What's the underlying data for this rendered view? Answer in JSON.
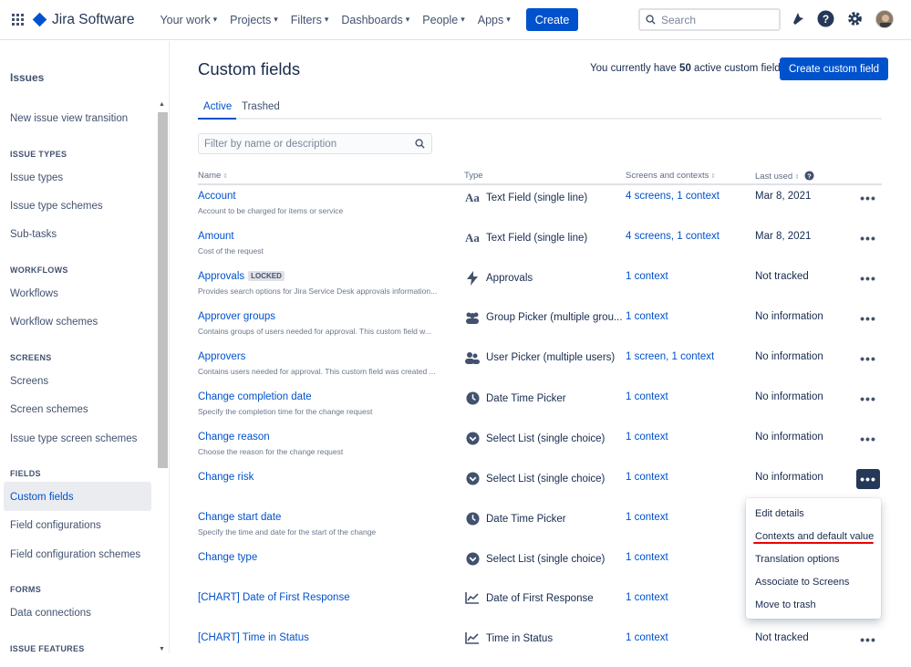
{
  "topnav": {
    "product": "Jira Software",
    "items": [
      "Your work",
      "Projects",
      "Filters",
      "Dashboards",
      "People",
      "Apps"
    ],
    "create_label": "Create",
    "search_placeholder": "Search",
    "icons": [
      "notifications-icon",
      "help-icon",
      "settings-icon",
      "avatar"
    ]
  },
  "sidebar": {
    "title": "Issues",
    "transition": "New issue view transition",
    "sections": {
      "issue_types": "ISSUE TYPES",
      "workflows": "WORKFLOWS",
      "screens": "SCREENS",
      "fields": "FIELDS",
      "forms": "FORMS",
      "issue_features": "ISSUE FEATURES"
    },
    "items": {
      "issue_types": "Issue types",
      "issue_type_schemes": "Issue type schemes",
      "sub_tasks": "Sub-tasks",
      "workflows": "Workflows",
      "workflow_schemes": "Workflow schemes",
      "screens": "Screens",
      "screen_schemes": "Screen schemes",
      "issue_type_screen_schemes": "Issue type screen schemes",
      "custom_fields": "Custom fields",
      "field_configurations": "Field configurations",
      "field_configuration_schemes": "Field configuration schemes",
      "data_connections": "Data connections"
    }
  },
  "main": {
    "title": "Custom fields",
    "count_prefix": "You currently have",
    "count_value": "50",
    "count_suffix": "active custom fields",
    "create_button": "Create custom field",
    "tabs": [
      "Active",
      "Trashed"
    ],
    "filter_placeholder": "Filter by name or description",
    "columns": {
      "name": "Name",
      "type": "Type",
      "screens": "Screens and contexts",
      "last_used": "Last used"
    },
    "rows": [
      {
        "name": "Account",
        "desc": "Account to be charged for items or service",
        "type": "Text Field (single line)",
        "icon": "text-field-icon",
        "screens": "4 screens, 1 context",
        "last_used": "Mar 8, 2021"
      },
      {
        "name": "Amount",
        "desc": "Cost of the request",
        "type": "Text Field (single line)",
        "icon": "text-field-icon",
        "screens": "4 screens, 1 context",
        "last_used": "Mar 8, 2021"
      },
      {
        "name": "Approvals",
        "badge": "LOCKED",
        "desc": "Provides search options for Jira Service Desk approvals information...",
        "type": "Approvals",
        "icon": "lightning-icon",
        "screens": "1 context",
        "last_used": "Not tracked"
      },
      {
        "name": "Approver groups",
        "desc": "Contains groups of users needed for approval. This custom field w...",
        "type": "Group Picker (multiple grou...",
        "icon": "group-icon",
        "screens": "1 context",
        "last_used": "No information"
      },
      {
        "name": "Approvers",
        "desc": "Contains users needed for approval. This custom field was created ...",
        "type": "User Picker (multiple users)",
        "icon": "users-icon",
        "screens": "1 screen, 1 context",
        "last_used": "No information"
      },
      {
        "name": "Change completion date",
        "desc": "Specify the completion time for the change request",
        "type": "Date Time Picker",
        "icon": "clock-icon",
        "screens": "1 context",
        "last_used": "No information"
      },
      {
        "name": "Change reason",
        "desc": "Choose the reason for the change request",
        "type": "Select List (single choice)",
        "icon": "select-icon",
        "screens": "1 context",
        "last_used": "No information"
      },
      {
        "name": "Change risk",
        "desc": "",
        "type": "Select List (single choice)",
        "icon": "select-icon",
        "screens": "1 context",
        "last_used": "No information"
      },
      {
        "name": "Change start date",
        "desc": "Specify the time and date for the start of the change",
        "type": "Date Time Picker",
        "icon": "clock-icon",
        "screens": "1 context",
        "last_used": ""
      },
      {
        "name": "Change type",
        "desc": "",
        "type": "Select List (single choice)",
        "icon": "select-icon",
        "screens": "1 context",
        "last_used": ""
      },
      {
        "name": "[CHART] Date of First Response",
        "desc": "",
        "type": "Date of First Response",
        "icon": "chart-icon",
        "screens": "1 context",
        "last_used": ""
      },
      {
        "name": "[CHART] Time in Status",
        "desc": "",
        "type": "Time in Status",
        "icon": "chart-icon",
        "screens": "1 context",
        "last_used": "Not tracked"
      }
    ],
    "menu": [
      "Edit details",
      "Contexts and default value",
      "Translation options",
      "Associate to Screens",
      "Move to trash"
    ]
  }
}
